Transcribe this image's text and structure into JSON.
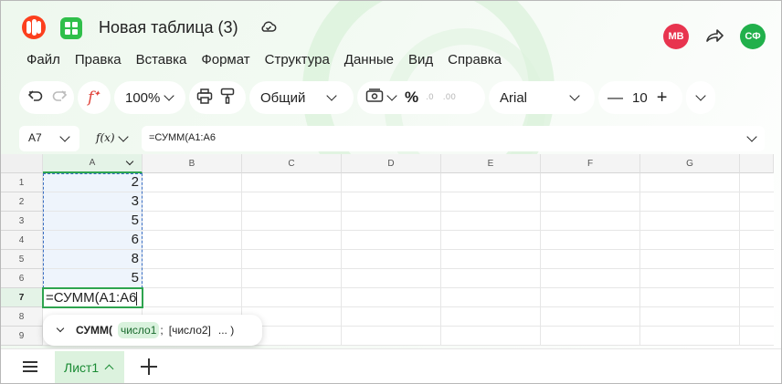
{
  "title": "Новая таблица (3)",
  "avatars": [
    {
      "initials": "МВ",
      "color": "#e8344f"
    },
    {
      "initials": "СФ",
      "color": "#21b04b"
    }
  ],
  "menu": [
    "Файл",
    "Правка",
    "Вставка",
    "Формат",
    "Структура",
    "Данные",
    "Вид",
    "Справка"
  ],
  "toolbar": {
    "zoom": "100%",
    "number_format": "Общий",
    "percent": "%",
    "decimal_dec": ".0",
    "decimal_inc": ".00",
    "font": "Arial",
    "font_size": "10",
    "minus": "—",
    "plus": "+"
  },
  "formula_bar": {
    "cell_ref": "A7",
    "fx": "f(x)",
    "formula": "=СУММ(A1:A6"
  },
  "columns": [
    "A",
    "B",
    "C",
    "D",
    "E",
    "F",
    "G"
  ],
  "rows": [
    "1",
    "2",
    "3",
    "4",
    "5",
    "6",
    "7",
    "8",
    "9"
  ],
  "cells_a": [
    "2",
    "3",
    "5",
    "6",
    "8",
    "5"
  ],
  "active_cell_text": "=СУММ(A1:A6",
  "hint": {
    "func": "СУММ(",
    "arg1": "число1",
    "sep": ";",
    "arg2": "[число2]",
    "more": "... )"
  },
  "sheet_tab": "Лист1",
  "colors": {
    "accent": "#21a038",
    "active_border": "#2ea44f"
  }
}
